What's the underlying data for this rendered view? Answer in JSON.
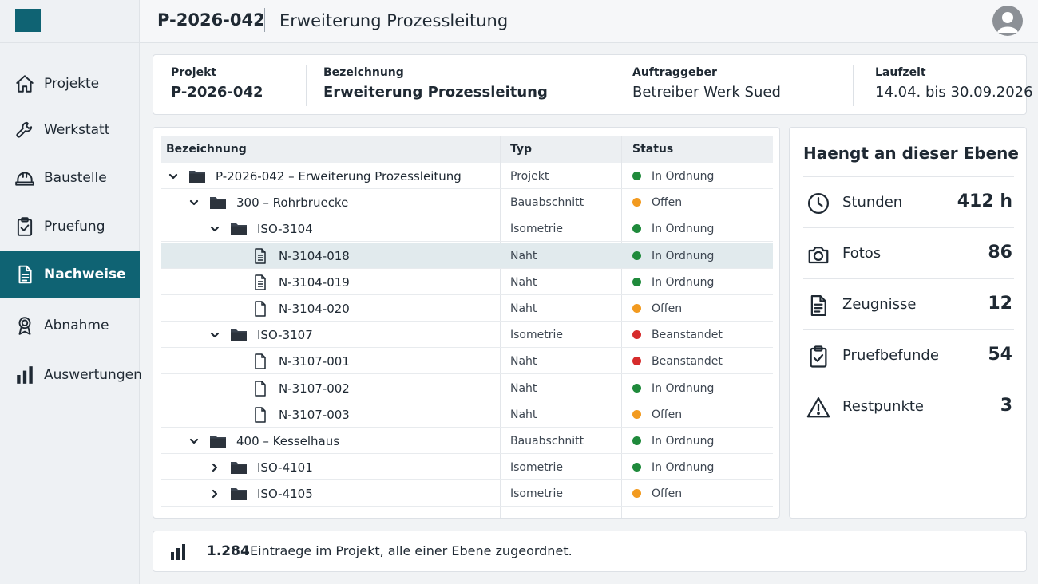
{
  "colors": {
    "accent": "#0f6373",
    "status_ok": "#1f8a3b",
    "status_open": "#f29a1f",
    "status_issue": "#d62b2b"
  },
  "sidebar": {
    "logo": "logo-square",
    "items": [
      {
        "label": "Projekte",
        "icon": "home-icon",
        "active": false
      },
      {
        "label": "Werkstatt",
        "icon": "wrench-icon",
        "active": false
      },
      {
        "label": "Baustelle",
        "icon": "hardhat-icon",
        "active": false
      },
      {
        "label": "Pruefung",
        "icon": "clipboard-check-icon",
        "active": false
      },
      {
        "label": "Nachweise",
        "icon": "document-icon",
        "active": true
      },
      {
        "label": "Abnahme",
        "icon": "award-icon",
        "active": false
      },
      {
        "label": "Auswertungen",
        "icon": "bar-chart-icon",
        "active": false
      }
    ]
  },
  "header": {
    "project_id": "P-2026-042",
    "title": "Erweiterung Prozessleitung",
    "avatar": "user-avatar-icon"
  },
  "info": {
    "project_label": "Projekt",
    "project_value": "P-2026-042",
    "name_label": "Bezeichnung",
    "name_value": "Erweiterung Prozessleitung",
    "client_label": "Auftraggeber",
    "client_value": "Betreiber Werk Sued",
    "period_label": "Laufzeit",
    "period_value": "14.04. bis 30.09.2026"
  },
  "tree": {
    "headers": {
      "name": "Bezeichnung",
      "type": "Typ",
      "status": "Status"
    },
    "rows": [
      {
        "level": 0,
        "expander": "down",
        "icon": "folder-icon",
        "name": "P-2026-042 – Erweiterung Prozessleitung",
        "type": "Projekt",
        "status": "In Ordnung",
        "status_kind": "ok",
        "selected": false
      },
      {
        "level": 1,
        "expander": "down",
        "icon": "folder-icon",
        "name": "300 – Rohrbruecke",
        "type": "Bauabschnitt",
        "status": "Offen",
        "status_kind": "open",
        "selected": false
      },
      {
        "level": 2,
        "expander": "down",
        "icon": "folder-icon",
        "name": "ISO-3104",
        "type": "Isometrie",
        "status": "In Ordnung",
        "status_kind": "ok",
        "selected": false
      },
      {
        "level": 3,
        "expander": "none",
        "icon": "document-lines-icon",
        "name": "N-3104-018",
        "type": "Naht",
        "status": "In Ordnung",
        "status_kind": "ok",
        "selected": true
      },
      {
        "level": 3,
        "expander": "none",
        "icon": "document-lines-icon",
        "name": "N-3104-019",
        "type": "Naht",
        "status": "In Ordnung",
        "status_kind": "ok",
        "selected": false
      },
      {
        "level": 3,
        "expander": "none",
        "icon": "document-icon",
        "name": "N-3104-020",
        "type": "Naht",
        "status": "Offen",
        "status_kind": "open",
        "selected": false
      },
      {
        "level": 2,
        "expander": "down",
        "icon": "folder-icon",
        "name": "ISO-3107",
        "type": "Isometrie",
        "status": "Beanstandet",
        "status_kind": "issue",
        "selected": false
      },
      {
        "level": 3,
        "expander": "none",
        "icon": "document-icon",
        "name": "N-3107-001",
        "type": "Naht",
        "status": "Beanstandet",
        "status_kind": "issue",
        "selected": false
      },
      {
        "level": 3,
        "expander": "none",
        "icon": "document-icon",
        "name": "N-3107-002",
        "type": "Naht",
        "status": "In Ordnung",
        "status_kind": "ok",
        "selected": false
      },
      {
        "level": 3,
        "expander": "none",
        "icon": "document-icon",
        "name": "N-3107-003",
        "type": "Naht",
        "status": "Offen",
        "status_kind": "open",
        "selected": false
      },
      {
        "level": 1,
        "expander": "down",
        "icon": "folder-icon",
        "name": "400 – Kesselhaus",
        "type": "Bauabschnitt",
        "status": "In Ordnung",
        "status_kind": "ok",
        "selected": false
      },
      {
        "level": 2,
        "expander": "right",
        "icon": "folder-icon",
        "name": "ISO-4101",
        "type": "Isometrie",
        "status": "In Ordnung",
        "status_kind": "ok",
        "selected": false
      },
      {
        "level": 2,
        "expander": "right",
        "icon": "folder-icon",
        "name": "ISO-4105",
        "type": "Isometrie",
        "status": "Offen",
        "status_kind": "open",
        "selected": false
      }
    ]
  },
  "side_panel": {
    "title": "Haengt an dieser Ebene",
    "stats": [
      {
        "icon": "clock-icon",
        "label": "Stunden",
        "value": "412 h"
      },
      {
        "icon": "camera-icon",
        "label": "Fotos",
        "value": "86"
      },
      {
        "icon": "certificate-doc-icon",
        "label": "Zeugnisse",
        "value": "12"
      },
      {
        "icon": "clipboard-check-icon",
        "label": "Pruefbefunde",
        "value": "54"
      },
      {
        "icon": "warning-icon",
        "label": "Restpunkte",
        "value": "3"
      }
    ]
  },
  "footer": {
    "icon": "bar-chart-icon",
    "count": "1.284",
    "text": "Eintraege im Projekt, alle einer Ebene zugeordnet."
  }
}
